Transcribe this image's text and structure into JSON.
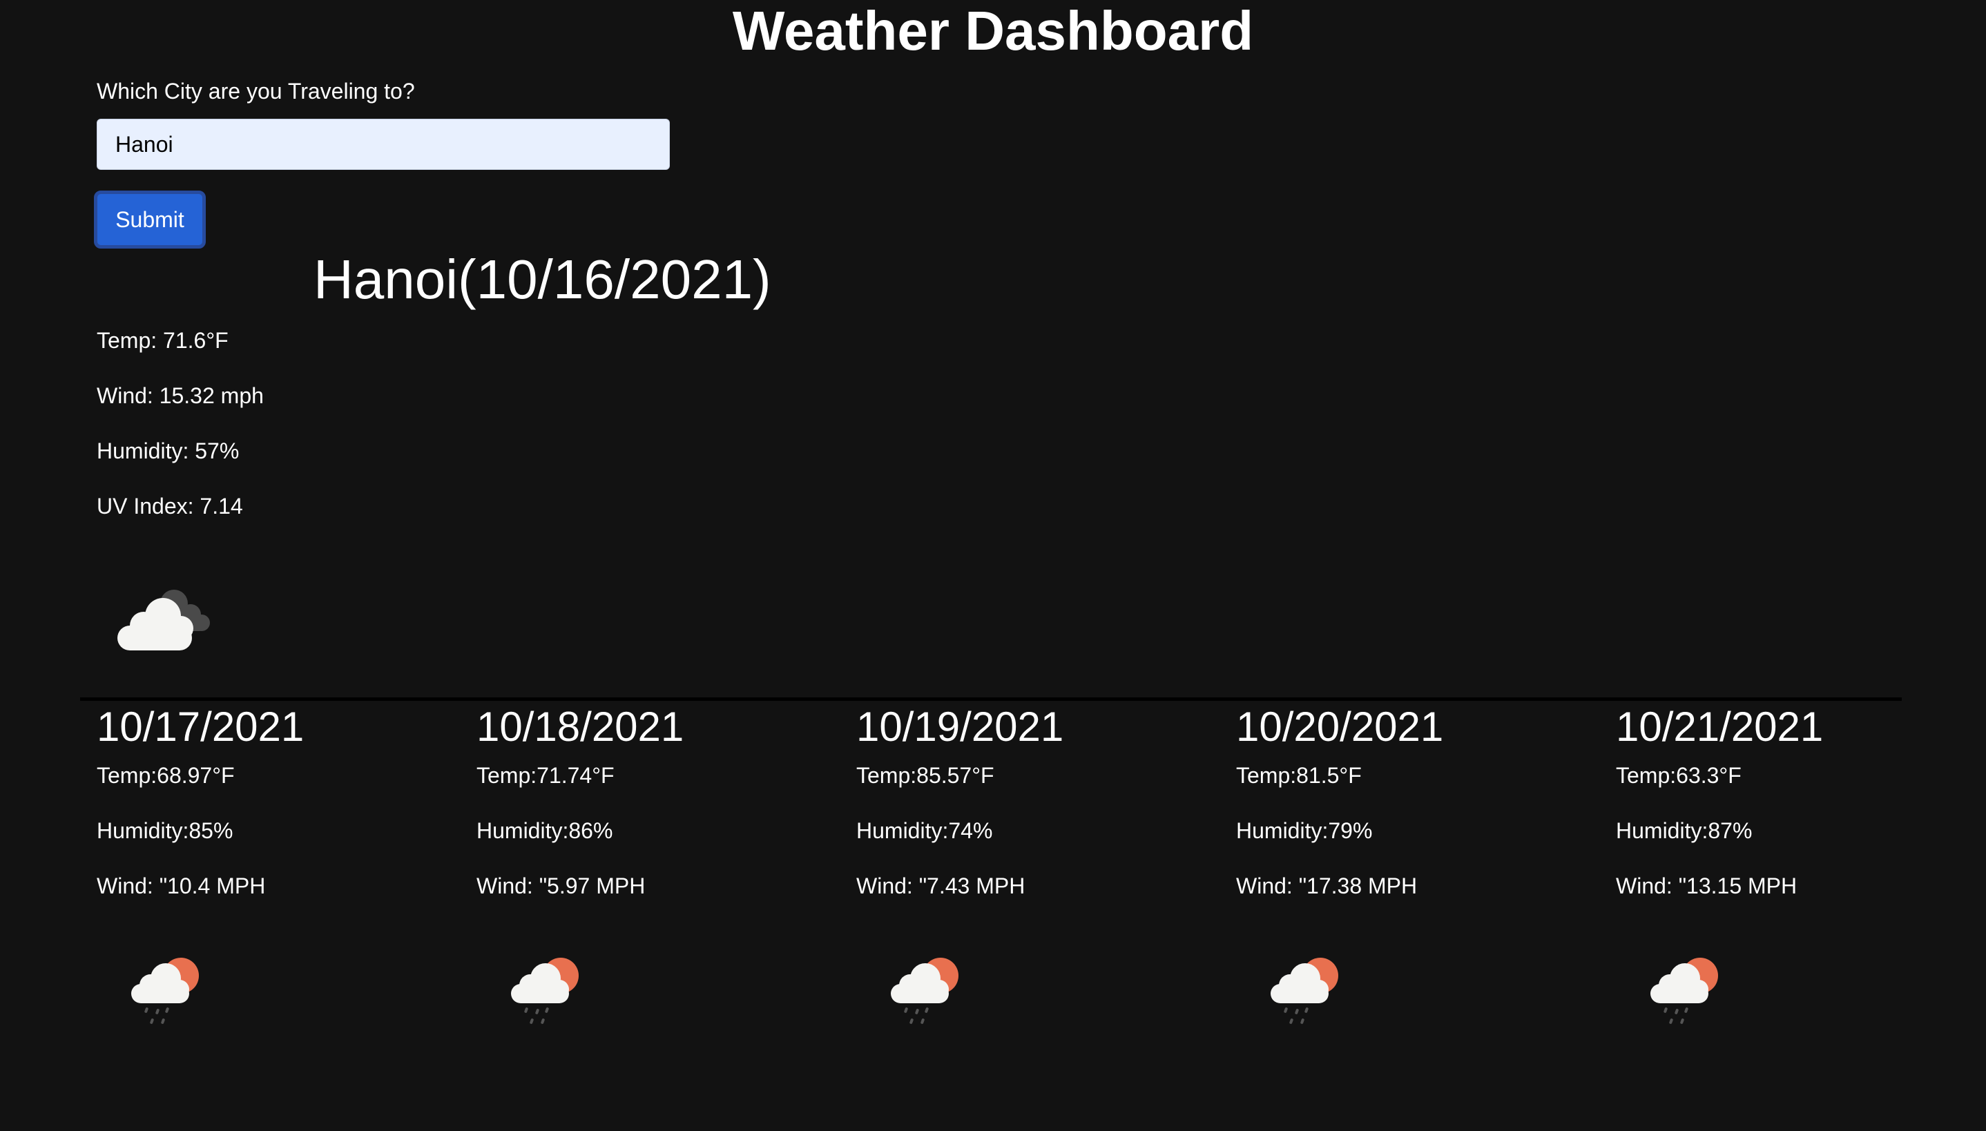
{
  "header": {
    "title": "Weather Dashboard"
  },
  "search": {
    "label": "Which City are you Traveling to?",
    "value": "Hanoi",
    "submit_label": "Submit"
  },
  "current": {
    "heading": "Hanoi(10/16/2021)",
    "temp": "Temp: 71.6°F",
    "wind": "Wind: 15.32 mph",
    "humidity": "Humidity: 57%",
    "uv": "UV Index: 7.14",
    "icon": "overcast-clouds-icon"
  },
  "forecast": [
    {
      "date": "10/17/2021",
      "temp": "Temp:68.97°F",
      "humidity": "Humidity:85%",
      "wind": "Wind: \"10.4 MPH",
      "icon": "light-rain-day-icon"
    },
    {
      "date": "10/18/2021",
      "temp": "Temp:71.74°F",
      "humidity": "Humidity:86%",
      "wind": "Wind: \"5.97 MPH",
      "icon": "light-rain-day-icon"
    },
    {
      "date": "10/19/2021",
      "temp": "Temp:85.57°F",
      "humidity": "Humidity:74%",
      "wind": "Wind: \"7.43 MPH",
      "icon": "light-rain-day-icon"
    },
    {
      "date": "10/20/2021",
      "temp": "Temp:81.5°F",
      "humidity": "Humidity:79%",
      "wind": "Wind: \"17.38 MPH",
      "icon": "light-rain-day-icon"
    },
    {
      "date": "10/21/2021",
      "temp": "Temp:63.3°F",
      "humidity": "Humidity:87%",
      "wind": "Wind: \"13.15 MPH",
      "icon": "light-rain-day-icon"
    }
  ],
  "colors": {
    "background": "#121212",
    "text": "#ffffff",
    "button": "#2563d6",
    "button_border": "#274b9e",
    "input_background": "#e8f0fe",
    "sun": "#e8704f"
  }
}
